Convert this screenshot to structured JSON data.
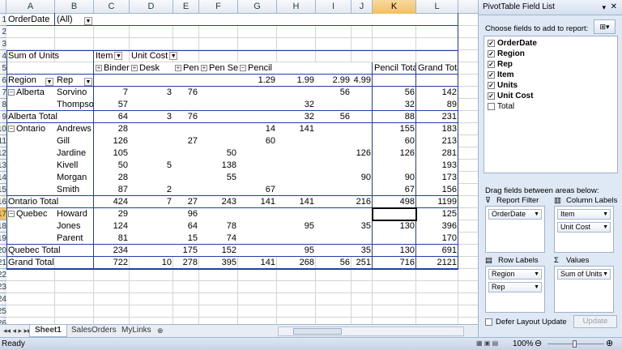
{
  "sheet": {
    "columns": [
      "A",
      "B",
      "C",
      "D",
      "E",
      "F",
      "G",
      "H",
      "I",
      "J",
      "K",
      "L"
    ],
    "selected_column": "K",
    "row_numbers": [
      "1",
      "2",
      "3",
      "4",
      "5",
      "6",
      "7",
      "8",
      "9",
      "10",
      "11",
      "12",
      "13",
      "14",
      "15",
      "16",
      "17",
      "18",
      "19",
      "20",
      "21",
      "22",
      "23",
      "24",
      "25",
      "26"
    ],
    "selected_row": "17",
    "cells": {
      "orderdate_label": "OrderDate",
      "orderdate_value": "(All)",
      "sum_of_units": "Sum of Units",
      "item_header": "Item",
      "unit_cost_header": "Unit Cost",
      "region_header": "Region",
      "rep_header": "Rep",
      "binder": "Binder",
      "desk": "Desk",
      "pen": "Pen",
      "pen_set": "Pen Set",
      "pencil": "Pencil",
      "pencil_total": "Pencil Total",
      "grand_total": "Grand Total",
      "cost_129": "1.29",
      "cost_199": "1.99",
      "cost_299": "2.99",
      "cost_499": "4.99"
    },
    "rows": [
      {
        "region": "Alberta",
        "rep": "Sorvino",
        "values": [
          "7",
          "3",
          "76",
          "",
          "",
          "",
          "56",
          "",
          "56",
          "142"
        ]
      },
      {
        "region": "",
        "rep": "Thompson",
        "values": [
          "57",
          "",
          "",
          "",
          "",
          "32",
          "",
          "",
          "32",
          "89"
        ]
      },
      {
        "region": "Alberta Total",
        "rep": "",
        "values": [
          "64",
          "3",
          "76",
          "",
          "",
          "32",
          "56",
          "",
          "88",
          "231"
        ],
        "total": true
      },
      {
        "region": "Ontario",
        "rep": "Andrews",
        "values": [
          "28",
          "",
          "",
          "",
          "14",
          "141",
          "",
          "",
          "155",
          "183"
        ]
      },
      {
        "region": "",
        "rep": "Gill",
        "values": [
          "126",
          "",
          "27",
          "",
          "60",
          "",
          "",
          "",
          "60",
          "213"
        ]
      },
      {
        "region": "",
        "rep": "Jardine",
        "values": [
          "105",
          "",
          "",
          "50",
          "",
          "",
          "",
          "126",
          "126",
          "281"
        ]
      },
      {
        "region": "",
        "rep": "Kivell",
        "values": [
          "50",
          "5",
          "",
          "138",
          "",
          "",
          "",
          "",
          "",
          "193"
        ]
      },
      {
        "region": "",
        "rep": "Morgan",
        "values": [
          "28",
          "",
          "",
          "55",
          "",
          "",
          "",
          "90",
          "90",
          "173"
        ]
      },
      {
        "region": "",
        "rep": "Smith",
        "values": [
          "87",
          "2",
          "",
          "",
          "67",
          "",
          "",
          "",
          "67",
          "156"
        ]
      },
      {
        "region": "Ontario Total",
        "rep": "",
        "values": [
          "424",
          "7",
          "27",
          "243",
          "141",
          "141",
          "",
          "216",
          "498",
          "1199"
        ],
        "total": true
      },
      {
        "region": "Quebec",
        "rep": "Howard",
        "values": [
          "29",
          "",
          "96",
          "",
          "",
          "",
          "",
          "",
          "",
          "125"
        ]
      },
      {
        "region": "",
        "rep": "Jones",
        "values": [
          "124",
          "",
          "64",
          "78",
          "",
          "95",
          "",
          "35",
          "130",
          "396"
        ]
      },
      {
        "region": "",
        "rep": "Parent",
        "values": [
          "81",
          "",
          "15",
          "74",
          "",
          "",
          "",
          "",
          "",
          "170"
        ]
      },
      {
        "region": "Quebec Total",
        "rep": "",
        "values": [
          "234",
          "",
          "175",
          "152",
          "",
          "95",
          "",
          "35",
          "130",
          "691"
        ],
        "total": true
      },
      {
        "region": "Grand Total",
        "rep": "",
        "values": [
          "722",
          "10",
          "278",
          "395",
          "141",
          "268",
          "56",
          "251",
          "716",
          "2121"
        ],
        "total": true
      }
    ]
  },
  "tabs": {
    "sheet1": "Sheet1",
    "salesorders": "SalesOrders",
    "mylinks": "MyLinks"
  },
  "status": {
    "ready": "Ready",
    "zoom": "100%"
  },
  "panel": {
    "title": "PivotTable Field List",
    "choose_label": "Choose fields to add to report:",
    "fields": [
      {
        "name": "OrderDate",
        "checked": true
      },
      {
        "name": "Region",
        "checked": true
      },
      {
        "name": "Rep",
        "checked": true
      },
      {
        "name": "Item",
        "checked": true
      },
      {
        "name": "Units",
        "checked": true
      },
      {
        "name": "Unit Cost",
        "checked": true
      },
      {
        "name": "Total",
        "checked": false
      }
    ],
    "drag_label": "Drag fields between areas below:",
    "report_filter": "Report Filter",
    "column_labels": "Column Labels",
    "row_labels": "Row Labels",
    "values": "Values",
    "filter_items": [
      "OrderDate"
    ],
    "column_items": [
      "Item",
      "Unit Cost"
    ],
    "row_items": [
      "Region",
      "Rep"
    ],
    "value_items": [
      "Sum of Units"
    ],
    "defer_label": "Defer Layout Update",
    "update_label": "Update"
  }
}
